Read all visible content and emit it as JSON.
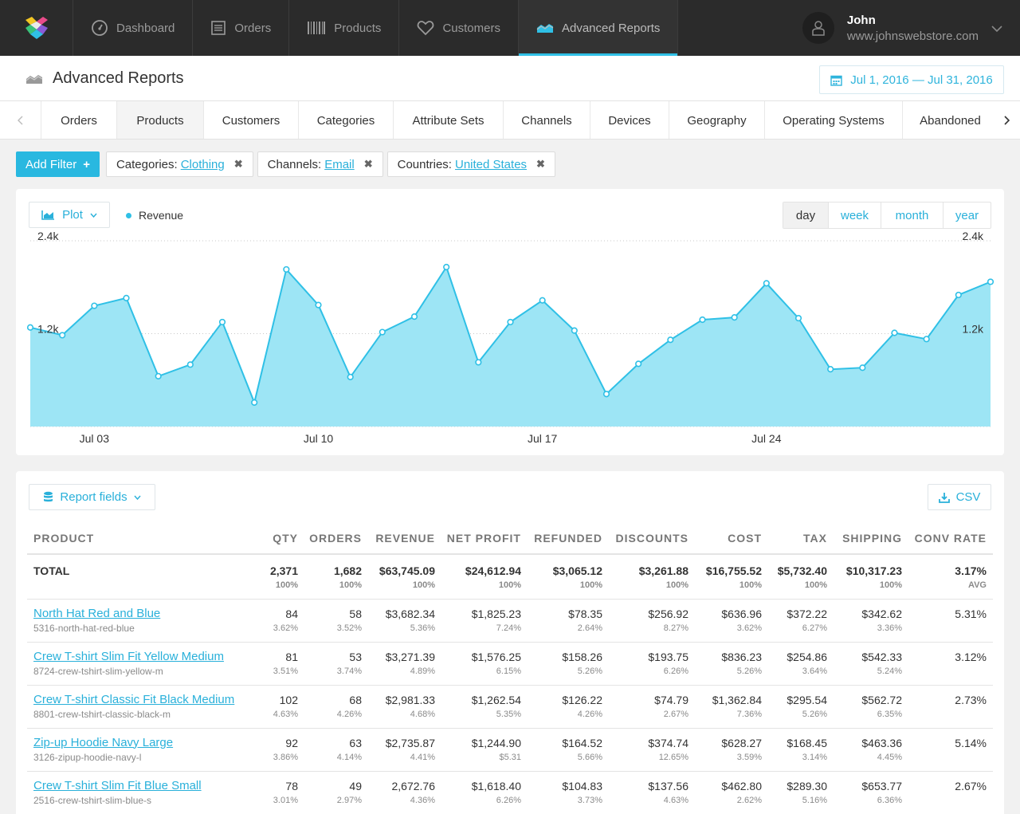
{
  "nav": {
    "items": [
      {
        "label": "Dashboard",
        "icon": "dashboard-gauge-icon"
      },
      {
        "label": "Orders",
        "icon": "orders-list-icon"
      },
      {
        "label": "Products",
        "icon": "barcode-icon"
      },
      {
        "label": "Customers",
        "icon": "heart-icon"
      },
      {
        "label": "Advanced Reports",
        "icon": "reports-area-icon",
        "active": true
      }
    ],
    "user": {
      "name": "John",
      "site": "www.johnswebstore.com"
    }
  },
  "header": {
    "title": "Advanced Reports",
    "date_range": "Jul 1, 2016 — Jul 31, 2016"
  },
  "tabs": [
    "Orders",
    "Products",
    "Customers",
    "Categories",
    "Attribute Sets",
    "Channels",
    "Devices",
    "Geography",
    "Operating Systems",
    "Abandoned"
  ],
  "active_tab": "Products",
  "filters": {
    "add_label": "Add Filter",
    "chips": [
      {
        "key": "Categories:",
        "value": "Clothing"
      },
      {
        "key": "Channels:",
        "value": "Email"
      },
      {
        "key": "Countries:",
        "value": "United States"
      }
    ]
  },
  "chart_controls": {
    "plot_label": "Plot",
    "periods": [
      "day",
      "week",
      "month",
      "year"
    ],
    "active_period": "day"
  },
  "chart_data": {
    "type": "area",
    "series": [
      {
        "name": "Revenue",
        "values": [
          1280,
          1180,
          1560,
          1660,
          650,
          800,
          1350,
          310,
          2030,
          1570,
          640,
          1220,
          1420,
          2060,
          830,
          1350,
          1630,
          1240,
          420,
          810,
          1120,
          1380,
          1410,
          1850,
          1400,
          740,
          760,
          1210,
          1130,
          1700,
          1870
        ]
      }
    ],
    "x": [
      "Jul 01",
      "Jul 02",
      "Jul 03",
      "Jul 04",
      "Jul 05",
      "Jul 06",
      "Jul 07",
      "Jul 08",
      "Jul 09",
      "Jul 10",
      "Jul 11",
      "Jul 12",
      "Jul 13",
      "Jul 14",
      "Jul 15",
      "Jul 16",
      "Jul 17",
      "Jul 18",
      "Jul 19",
      "Jul 20",
      "Jul 21",
      "Jul 22",
      "Jul 23",
      "Jul 24",
      "Jul 25",
      "Jul 26",
      "Jul 27",
      "Jul 28",
      "Jul 29",
      "Jul 30",
      "Jul 31"
    ],
    "x_tick_labels": [
      "Jul 03",
      "Jul 10",
      "Jul 17",
      "Jul 24"
    ],
    "x_tick_indices": [
      2,
      9,
      16,
      23
    ],
    "y_tick_labels": [
      "2.4k",
      "1.2k"
    ],
    "y_tick_values": [
      2400,
      1200
    ],
    "ylim": [
      0,
      2400
    ],
    "grid": true,
    "color": "#2fc0e6",
    "fill": "#9de5f5"
  },
  "report": {
    "fields_label": "Report fields",
    "csv_label": "CSV",
    "columns": [
      "PRODUCT",
      "QTY",
      "ORDERS",
      "REVENUE",
      "NET PROFIT",
      "REFUNDED",
      "DISCOUNTS",
      "COST",
      "TAX",
      "SHIPPING",
      "CONV RATE"
    ],
    "total": {
      "label": "TOTAL",
      "cells": [
        {
          "v": "2,371",
          "s": "100%"
        },
        {
          "v": "1,682",
          "s": "100%"
        },
        {
          "v": "$63,745.09",
          "s": "100%"
        },
        {
          "v": "$24,612.94",
          "s": "100%"
        },
        {
          "v": "$3,065.12",
          "s": "100%"
        },
        {
          "v": "$3,261.88",
          "s": "100%"
        },
        {
          "v": "$16,755.52",
          "s": "100%"
        },
        {
          "v": "$5,732.40",
          "s": "100%"
        },
        {
          "v": "$10,317.23",
          "s": "100%"
        },
        {
          "v": "3.17%",
          "s": "AVG"
        }
      ]
    },
    "rows": [
      {
        "name": "North Hat Red and Blue",
        "sku": "5316-north-hat-red-blue",
        "cells": [
          {
            "v": "84",
            "s": "3.62%"
          },
          {
            "v": "58",
            "s": "3.52%"
          },
          {
            "v": "$3,682.34",
            "s": "5.36%"
          },
          {
            "v": "$1,825.23",
            "s": "7.24%"
          },
          {
            "v": "$78.35",
            "s": "2.64%"
          },
          {
            "v": "$256.92",
            "s": "8.27%"
          },
          {
            "v": "$636.96",
            "s": "3.62%"
          },
          {
            "v": "$372.22",
            "s": "6.27%"
          },
          {
            "v": "$342.62",
            "s": "3.36%"
          },
          {
            "v": "5.31%",
            "s": ""
          }
        ]
      },
      {
        "name": "Crew T-shirt Slim Fit Yellow Medium",
        "sku": "8724-crew-tshirt-slim-yellow-m",
        "cells": [
          {
            "v": "81",
            "s": "3.51%"
          },
          {
            "v": "53",
            "s": "3.74%"
          },
          {
            "v": "$3,271.39",
            "s": "4.89%"
          },
          {
            "v": "$1,576.25",
            "s": "6.15%"
          },
          {
            "v": "$158.26",
            "s": "5.26%"
          },
          {
            "v": "$193.75",
            "s": "6.26%"
          },
          {
            "v": "$836.23",
            "s": "5.26%"
          },
          {
            "v": "$254.86",
            "s": "3.64%"
          },
          {
            "v": "$542.33",
            "s": "5.24%"
          },
          {
            "v": "3.12%",
            "s": ""
          }
        ]
      },
      {
        "name": "Crew T-shirt Classic Fit Black Medium",
        "sku": "8801-crew-tshirt-classic-black-m",
        "cells": [
          {
            "v": "102",
            "s": "4.63%"
          },
          {
            "v": "68",
            "s": "4.26%"
          },
          {
            "v": "$2,981.33",
            "s": "4.68%"
          },
          {
            "v": "$1,262.54",
            "s": "5.35%"
          },
          {
            "v": "$126.22",
            "s": "4.26%"
          },
          {
            "v": "$74.79",
            "s": "2.67%"
          },
          {
            "v": "$1,362.84",
            "s": "7.36%"
          },
          {
            "v": "$295.54",
            "s": "5.26%"
          },
          {
            "v": "$562.72",
            "s": "6.35%"
          },
          {
            "v": "2.73%",
            "s": ""
          }
        ]
      },
      {
        "name": "Zip-up Hoodie Navy Large",
        "sku": "3126-zipup-hoodie-navy-l",
        "cells": [
          {
            "v": "92",
            "s": "3.86%"
          },
          {
            "v": "63",
            "s": "4.14%"
          },
          {
            "v": "$2,735.87",
            "s": "4.41%"
          },
          {
            "v": "$1,244.90",
            "s": "$5.31"
          },
          {
            "v": "$164.52",
            "s": "5.66%"
          },
          {
            "v": "$374.74",
            "s": "12.65%"
          },
          {
            "v": "$628.27",
            "s": "3.59%"
          },
          {
            "v": "$168.45",
            "s": "3.14%"
          },
          {
            "v": "$463.36",
            "s": "4.45%"
          },
          {
            "v": "5.14%",
            "s": ""
          }
        ]
      },
      {
        "name": "Crew T-shirt Slim Fit Blue Small",
        "sku": "2516-crew-tshirt-slim-blue-s",
        "cells": [
          {
            "v": "78",
            "s": "3.01%"
          },
          {
            "v": "49",
            "s": "2.97%"
          },
          {
            "v": "2,672.76",
            "s": "4.36%"
          },
          {
            "v": "$1,618.40",
            "s": "6.26%"
          },
          {
            "v": "$104.83",
            "s": "3.73%"
          },
          {
            "v": "$137.56",
            "s": "4.63%"
          },
          {
            "v": "$462.80",
            "s": "2.62%"
          },
          {
            "v": "$289.30",
            "s": "5.16%"
          },
          {
            "v": "$653.77",
            "s": "6.36%"
          },
          {
            "v": "2.67%",
            "s": ""
          }
        ]
      }
    ]
  }
}
